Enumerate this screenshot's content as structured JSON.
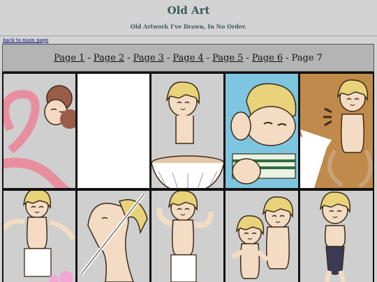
{
  "header": {
    "title": "Old Art",
    "subtitle": "Old Artwork I've Drawn, In No Order."
  },
  "nav": {
    "back_label": "back to main page"
  },
  "pagination": {
    "pages": [
      {
        "label": "Page 1",
        "current": false
      },
      {
        "label": "Page 2",
        "current": false
      },
      {
        "label": "Page 3",
        "current": false
      },
      {
        "label": "Page 4",
        "current": false
      },
      {
        "label": "Page 5",
        "current": false
      },
      {
        "label": "Page 6",
        "current": false
      },
      {
        "label": "Page 7",
        "current": true
      }
    ],
    "separator": "-"
  },
  "gallery": {
    "thumbnails": [
      {
        "subject": "pink-serpent-character",
        "bg": "#cfcfcf"
      },
      {
        "subject": "blank",
        "bg": "#ffffff"
      },
      {
        "subject": "blonde-character-in-bowl",
        "bg": "#cfcfcf"
      },
      {
        "subject": "blonde-character-relaxing",
        "bg": "#7ec6e0"
      },
      {
        "subject": "blonde-character-surprised",
        "bg": "#c08a4a"
      },
      {
        "subject": "blonde-character-stretching",
        "bg": "#cfcfcf"
      },
      {
        "subject": "melting-figure",
        "bg": "#cfcfcf"
      },
      {
        "subject": "blonde-character-flexing",
        "bg": "#cfcfcf"
      },
      {
        "subject": "two-blonde-characters",
        "bg": "#cfcfcf"
      },
      {
        "subject": "blonde-character-swimsuit",
        "bg": "#cfcfcf"
      }
    ]
  },
  "colors": {
    "title": "#3a5a5a",
    "page_bg": "#d3d3d3",
    "pager_bg": "#b4b4b4",
    "hair": "#e8d27a",
    "skin": "#f3dcc3"
  }
}
